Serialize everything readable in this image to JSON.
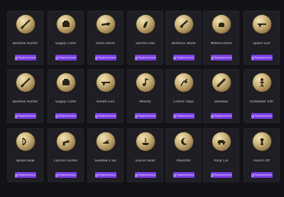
{
  "cards": [
    {
      "title": "Bamboo Hunter",
      "button": "Подписаться",
      "icon": "sword-icon"
    },
    {
      "title": "Supply Crate",
      "button": "Подписаться",
      "icon": "crate-icon"
    },
    {
      "title": "Hand Drone",
      "button": "Подписаться",
      "icon": "drone-icon"
    },
    {
      "title": "Sacred Fowl",
      "button": "Подписаться",
      "icon": "bird-icon"
    },
    {
      "title": "Demonic Blade",
      "button": "Подписаться",
      "icon": "blade-icon"
    },
    {
      "title": "Melted Dome",
      "button": "Подписаться",
      "icon": "dome-icon"
    },
    {
      "title": "Space Gun",
      "button": "Подписаться",
      "icon": "gun-icon"
    },
    {
      "title": "Bamboo Hunter",
      "button": "Подписаться",
      "icon": "sword-icon"
    },
    {
      "title": "Supply Crate",
      "button": "Подписаться",
      "icon": "crate-icon"
    },
    {
      "title": "Isolate Gun",
      "button": "Подписаться",
      "icon": "gun-icon"
    },
    {
      "title": "Melody",
      "button": "Подписаться",
      "icon": "music-icon"
    },
    {
      "title": "Cosmic Rope",
      "button": "Подписаться",
      "icon": "rope-icon"
    },
    {
      "title": "Baseball",
      "button": "Подписаться",
      "icon": "bat-icon"
    },
    {
      "title": "Outwalker X4h",
      "button": "Подписаться",
      "icon": "figure-icon"
    },
    {
      "title": "Spiked Bow",
      "button": "Подписаться",
      "icon": "bow-icon"
    },
    {
      "title": "Cannon Hunter",
      "button": "Подписаться",
      "icon": "cannon-icon"
    },
    {
      "title": "Swallow's Tail",
      "button": "Подписаться",
      "icon": "tail-icon"
    },
    {
      "title": "Glacier Boat",
      "button": "Подписаться",
      "icon": "boat-icon"
    },
    {
      "title": "Moonfall",
      "button": "Подписаться",
      "icon": "moon-icon"
    },
    {
      "title": "Alloy Car",
      "button": "Подписаться",
      "icon": "car-icon"
    },
    {
      "title": "Hunch Off",
      "button": "Подписаться",
      "icon": "chess-icon"
    }
  ]
}
